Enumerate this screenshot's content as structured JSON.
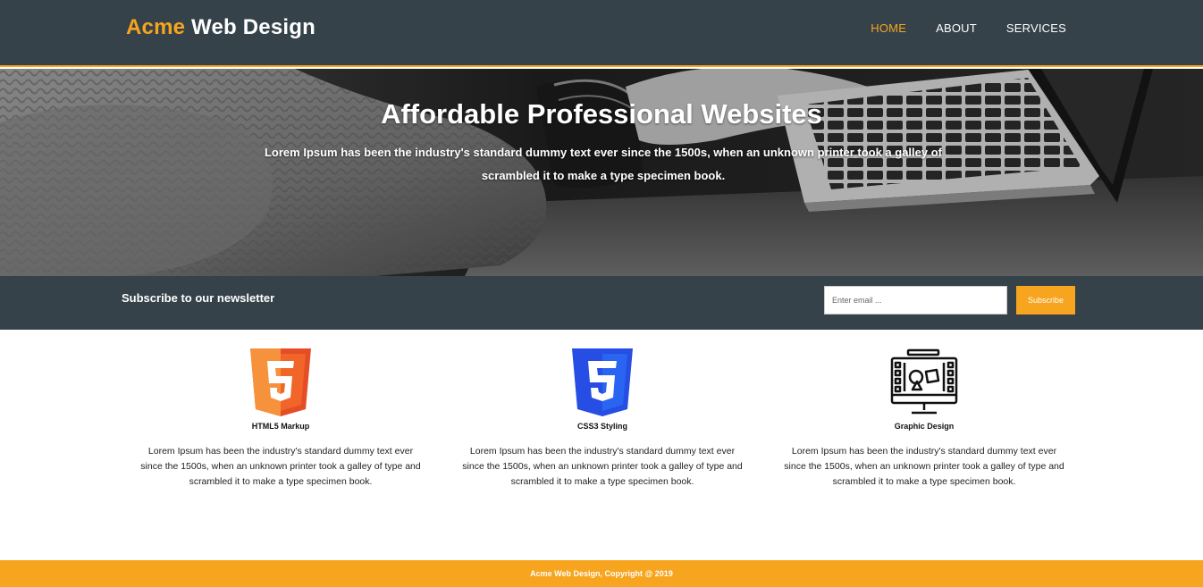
{
  "header": {
    "brand_highlight": "Acme",
    "brand_rest": " Web Design",
    "nav": [
      {
        "label": "HOME"
      },
      {
        "label": "ABOUT"
      },
      {
        "label": "SERVICES"
      }
    ]
  },
  "hero": {
    "title": "Affordable Professional Websites",
    "text": "Lorem Ipsum has been the industry's standard dummy text ever since the 1500s, when an unknown printer took a galley of scrambled it to make a type specimen book."
  },
  "newsletter": {
    "title": "Subscribe to our newsletter",
    "placeholder": "Enter email ...",
    "button": "Subscribe"
  },
  "boxes": [
    {
      "icon": "html5-icon",
      "title": "HTML5 Markup",
      "text": "Lorem Ipsum has been the industry's standard dummy text ever since the 1500s, when an unknown printer took a galley of type and scrambled it to make a type specimen book."
    },
    {
      "icon": "css3-icon",
      "title": "CSS3 Styling",
      "text": "Lorem Ipsum has been the industry's standard dummy text ever since the 1500s, when an unknown printer took a galley of type and scrambled it to make a type specimen book."
    },
    {
      "icon": "graphic-design-icon",
      "title": "Graphic Design",
      "text": "Lorem Ipsum has been the industry's standard dummy text ever since the 1500s, when an unknown printer took a galley of type and scrambled it to make a type specimen book."
    }
  ],
  "footer": {
    "copyright": "Acme Web Design, Copyright @ 2019"
  },
  "colors": {
    "accent": "#f7a41e",
    "dark": "#35424a",
    "html5": "#e44d26",
    "css3": "#264de4"
  }
}
